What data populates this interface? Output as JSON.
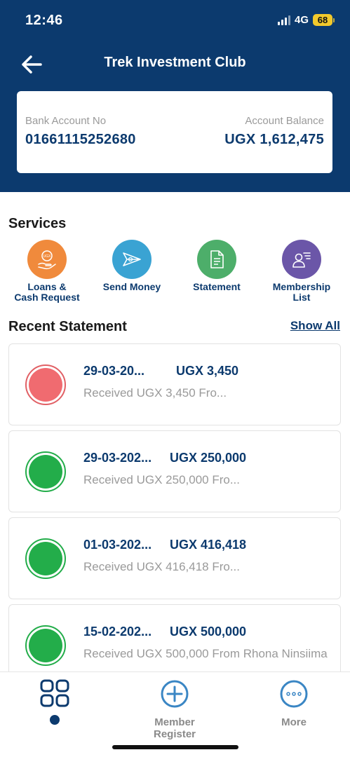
{
  "status_bar": {
    "time": "12:46",
    "network": "4G",
    "battery": "68"
  },
  "header": {
    "title": "Trek Investment Club",
    "back_icon": "arrow-left-icon"
  },
  "account": {
    "number_label": "Bank Account No",
    "number": "01661115252680",
    "balance_label": "Account Balance",
    "balance": "UGX 1,612,475"
  },
  "services": {
    "title": "Services",
    "items": [
      {
        "label": "Loans & Cash Request",
        "line1": "Loans &",
        "line2": "Cash Request",
        "icon": "hand-coin-icon",
        "color": "#f08a3c"
      },
      {
        "label": "Send Money",
        "line1": "Send Money",
        "line2": "",
        "icon": "paper-plane-icon",
        "color": "#3aa3d3"
      },
      {
        "label": "Statement",
        "line1": "Statement",
        "line2": "",
        "icon": "document-icon",
        "color": "#4dae6a"
      },
      {
        "label": "Membership List",
        "line1": "Membership",
        "line2": "List",
        "icon": "member-list-icon",
        "color": "#6b56a8"
      }
    ]
  },
  "recent": {
    "title": "Recent Statement",
    "show_all": "Show All",
    "items": [
      {
        "date": "29-03-20...",
        "amount": "UGX 3,450",
        "description": "Received UGX 3,450 Fro...",
        "status_color": "#f06b70",
        "ring_color": "#e16065"
      },
      {
        "date": "29-03-202...",
        "amount": "UGX 250,000",
        "description": "Received UGX 250,000 Fro...",
        "status_color": "#23ad4a",
        "ring_color": "#23ad4a"
      },
      {
        "date": "01-03-202...",
        "amount": "UGX 416,418",
        "description": "Received UGX 416,418 Fro...",
        "status_color": "#23ad4a",
        "ring_color": "#23ad4a"
      },
      {
        "date": "15-02-202...",
        "amount": "UGX 500,000",
        "description": "Received UGX 500,000 From Rhona Ninsiima",
        "status_color": "#23ad4a",
        "ring_color": "#23ad4a"
      }
    ]
  },
  "bottom_nav": {
    "home_icon": "grid-icon",
    "member_register": "Member Register",
    "more": "More"
  },
  "colors": {
    "brand_navy": "#0c3a6e",
    "battery_yellow": "#f2c92c"
  }
}
